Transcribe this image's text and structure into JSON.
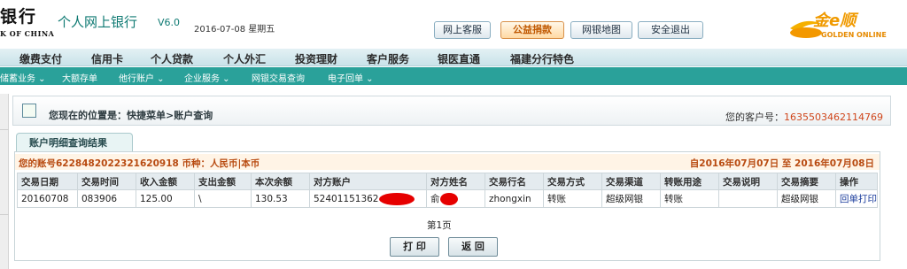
{
  "header": {
    "logo_cn": "银行",
    "logo_en": "K OF CHINA",
    "title": "个人网上银行",
    "version": "V6.0",
    "date": "2016-07-08 星期五",
    "buttons": [
      "网上客服",
      "公益捐款",
      "网银地图",
      "安全退出"
    ],
    "golden_logo_text": "金e顺",
    "golden_logo_en": "GOLDEN ONLINE",
    "accent": "#0f7a73"
  },
  "nav_main": [
    "缴费支付",
    "信用卡",
    "个人贷款",
    "个人外汇",
    "投资理财",
    "客户服务",
    "银医直通",
    "福建分行特色"
  ],
  "nav_sub": [
    "储蓄业务 ⌄",
    "大额存单",
    "他行账户 ⌄",
    "企业服务 ⌄",
    "网银交易查询",
    "电子回单 ⌄"
  ],
  "breadcrumb": {
    "text": "您现在的位置是：快捷菜单>账户查询",
    "customer_label": "您的客户号：",
    "customer_no": "1635503462114769"
  },
  "tab": {
    "label": "账户明细查询结果"
  },
  "account": {
    "summary": "您的账号6228482022321620918 币种：人民币|本币",
    "period": "自2016年07月07日 至 2016年07月08日"
  },
  "table": {
    "headers": [
      "交易日期",
      "交易时间",
      "收入金额",
      "支出金额",
      "本次余额",
      "对方账户",
      "对方姓名",
      "交易行名",
      "交易方式",
      "交易渠道",
      "转账用途",
      "交易说明",
      "交易摘要",
      "操作"
    ],
    "rows": [
      [
        "20160708",
        "083906",
        "125.00",
        "\\",
        "130.53",
        "52401151362",
        "俞",
        "zhongxin",
        "转账",
        "超级网银",
        "转账",
        "",
        "超级网银",
        "回单打印"
      ]
    ]
  },
  "pager": "第1页",
  "actions": {
    "print": "打 印",
    "back": "返 回"
  }
}
